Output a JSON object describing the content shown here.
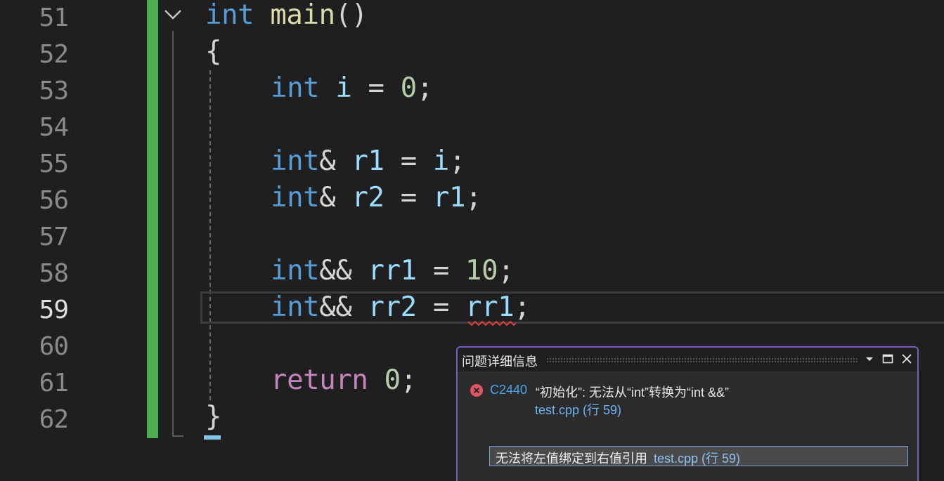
{
  "editor": {
    "line_numbers": [
      "51",
      "52",
      "53",
      "54",
      "55",
      "56",
      "57",
      "58",
      "59",
      "60",
      "61",
      "62"
    ],
    "current_line": "59",
    "lines": {
      "l51": {
        "kw": "int",
        "fn": "main",
        "punc": "()"
      },
      "l52": {
        "punc": "{"
      },
      "l53": {
        "kw": "int",
        "var": "i",
        "op": "=",
        "num": "0",
        "end": ";"
      },
      "l55": {
        "kw": "int",
        "amp": "&",
        "var": "r1",
        "op": "=",
        "rhs": "i",
        "end": ";"
      },
      "l56": {
        "kw": "int",
        "amp": "&",
        "var": "r2",
        "op": "=",
        "rhs": "r1",
        "end": ";"
      },
      "l58": {
        "kw": "int",
        "amp": "&&",
        "var": "rr1",
        "op": "=",
        "num": "10",
        "end": ";"
      },
      "l59": {
        "kw": "int",
        "amp": "&&",
        "var": "rr2",
        "op": "=",
        "rhs": "rr1",
        "end": ";"
      },
      "l61": {
        "kw": "return",
        "num": "0",
        "end": ";"
      },
      "l62": {
        "punc": "}"
      }
    }
  },
  "problem_panel": {
    "title": "问题详细信息",
    "error_code": "C2440",
    "error_message": "“初始化”: 无法从“int”转换为“int &&”",
    "error_location": "test.cpp (行 59)",
    "detail_text": "无法将左值绑定到右值引用",
    "detail_location": "test.cpp (行 59)"
  },
  "colors": {
    "keyword": "#569cd6",
    "return_keyword": "#c586c0",
    "function": "#dcdcaa",
    "variable": "#9cdcfe",
    "number": "#b5cea8",
    "change_bar": "#4caf50",
    "panel_border": "#7a5cc7",
    "error_icon": "#e05561"
  },
  "icons": {
    "fold": "chevron-down-icon",
    "error": "error-circle-icon",
    "dropdown": "caret-down-icon",
    "maximize": "maximize-icon",
    "close": "close-icon"
  }
}
